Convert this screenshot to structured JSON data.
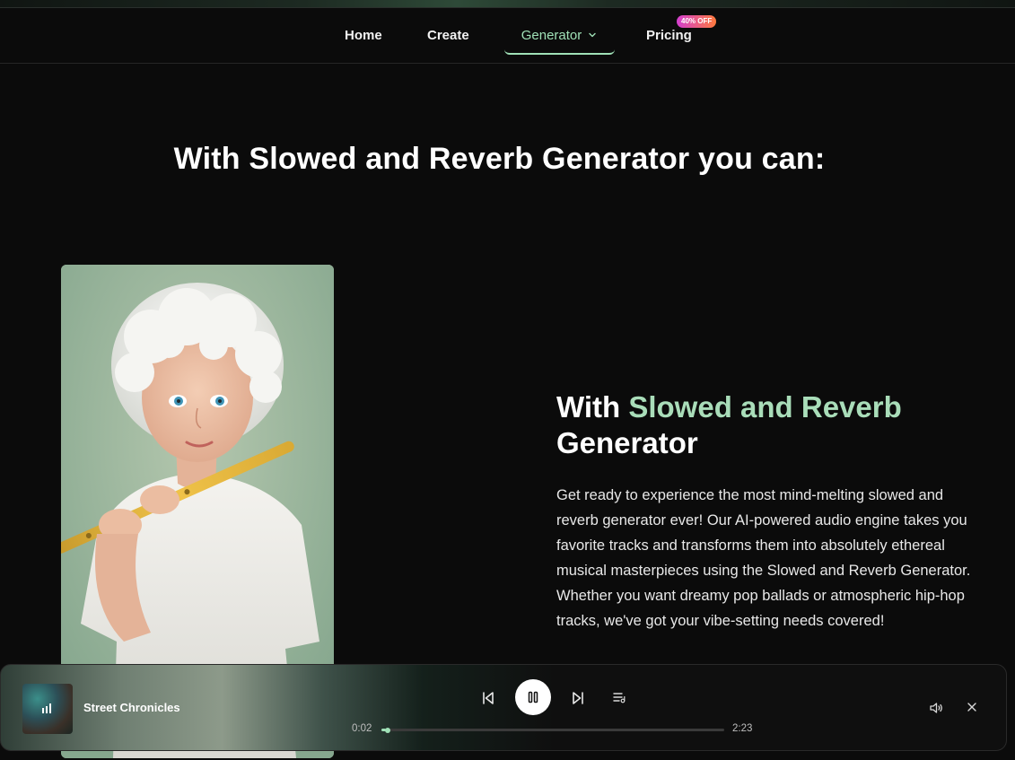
{
  "nav": {
    "home": "Home",
    "create": "Create",
    "generator": "Generator",
    "pricing": "Pricing",
    "pricing_badge": "40% OFF"
  },
  "headline": "With Slowed and Reverb Generator you can:",
  "feature": {
    "title_prefix": "With ",
    "title_accent": "Slowed and Reverb",
    "title_suffix": "Generator",
    "body_lines": [
      "Get ready to experience the most mind-melting slowed and",
      "reverb generator ever! Our AI-powered audio engine takes you",
      "favorite tracks and transforms them into absolutely ethereal",
      "musical masterpieces using the Slowed and Reverb Generator.",
      "Whether you want dreamy pop ballads or atmospheric hip-hop",
      "tracks, we've got your vibe-setting needs covered!"
    ]
  },
  "player": {
    "track_title": "Street Chronicles",
    "current_time": "0:02",
    "total_time": "2:23",
    "progress_fraction": 0.014
  },
  "colors": {
    "accent": "#9fe0b6",
    "background": "#0b0b0b"
  },
  "icons": [
    "chevron-down-icon",
    "skip-back-icon",
    "pause-icon",
    "skip-forward-icon",
    "queue-icon",
    "volume-icon",
    "close-icon",
    "equalizer-icon"
  ]
}
